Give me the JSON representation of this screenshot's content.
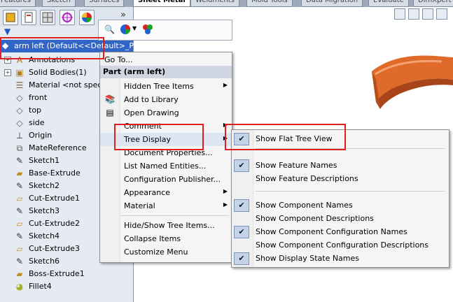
{
  "tabs": [
    "Features",
    "Sketch",
    "Surfaces",
    "Sheet Metal",
    "Weldments",
    "Mold Tools",
    "Data Migration",
    "Evaluate",
    "DimXpert"
  ],
  "active_tab": "Sheet Metal",
  "tree": {
    "root_label": "arm left  (Default<<Default>_Pho",
    "nodes": [
      {
        "label": "Annotations",
        "icon": "annotations-icon",
        "expandable": true
      },
      {
        "label": "Solid Bodies(1)",
        "icon": "solid-bodies-icon",
        "expandable": true
      },
      {
        "label": "Material <not specified>",
        "icon": "material-icon",
        "expandable": false
      },
      {
        "label": "front",
        "icon": "plane-icon",
        "expandable": false
      },
      {
        "label": "top",
        "icon": "plane-icon",
        "expandable": false
      },
      {
        "label": "side",
        "icon": "plane-icon",
        "expandable": false
      },
      {
        "label": "Origin",
        "icon": "origin-icon",
        "expandable": false
      },
      {
        "label": "MateReference",
        "icon": "mate-reference-icon",
        "expandable": false
      },
      {
        "label": "Sketch1",
        "icon": "sketch-icon",
        "expandable": false
      },
      {
        "label": "Base-Extrude",
        "icon": "extrude-icon",
        "expandable": false
      },
      {
        "label": "Sketch2",
        "icon": "sketch-icon",
        "expandable": false
      },
      {
        "label": "Cut-Extrude1",
        "icon": "cut-extrude-icon",
        "expandable": false
      },
      {
        "label": "Sketch3",
        "icon": "sketch-icon",
        "expandable": false
      },
      {
        "label": "Cut-Extrude2",
        "icon": "cut-extrude-icon",
        "expandable": false
      },
      {
        "label": "Sketch4",
        "icon": "sketch-icon",
        "expandable": false
      },
      {
        "label": "Cut-Extrude3",
        "icon": "cut-extrude-icon",
        "expandable": false
      },
      {
        "label": "Sketch6",
        "icon": "sketch-icon",
        "expandable": false
      },
      {
        "label": "Boss-Extrude1",
        "icon": "extrude-icon",
        "expandable": false
      },
      {
        "label": "Fillet4",
        "icon": "fillet-icon",
        "expandable": false
      }
    ]
  },
  "context_menu": {
    "goto": "Go To...",
    "header": "Part (arm left)",
    "items": {
      "hidden_tree_items": "Hidden Tree Items",
      "add_to_library": "Add to Library",
      "open_drawing": "Open Drawing",
      "comment": "Comment",
      "tree_display": "Tree Display",
      "document_properties": "Document Properties...",
      "list_named_entities": "List Named Entities...",
      "configuration_publisher": "Configuration Publisher...",
      "appearance": "Appearance",
      "material": "Material",
      "hide_show_tree_items": "Hide/Show Tree Items...",
      "collapse_items": "Collapse Items",
      "customize_menu": "Customize Menu"
    }
  },
  "submenu": {
    "items": {
      "show_flat_tree_view": "Show Flat Tree View",
      "show_feature_names": "Show Feature Names",
      "show_feature_descriptions": "Show Feature Descriptions",
      "show_component_names": "Show Component Names",
      "show_component_descriptions": "Show Component Descriptions",
      "show_component_configuration_names": "Show Component Configuration Names",
      "show_component_configuration_descriptions": "Show Component Configuration Descriptions",
      "show_display_state_names": "Show Display State Names"
    },
    "checked": [
      "show_flat_tree_view",
      "show_feature_names",
      "show_component_names",
      "show_component_configuration_names",
      "show_display_state_names"
    ]
  },
  "colors": {
    "highlight_box": "#e02020",
    "tree_selection": "#3166c6",
    "part_orange": "#e06a2a"
  }
}
